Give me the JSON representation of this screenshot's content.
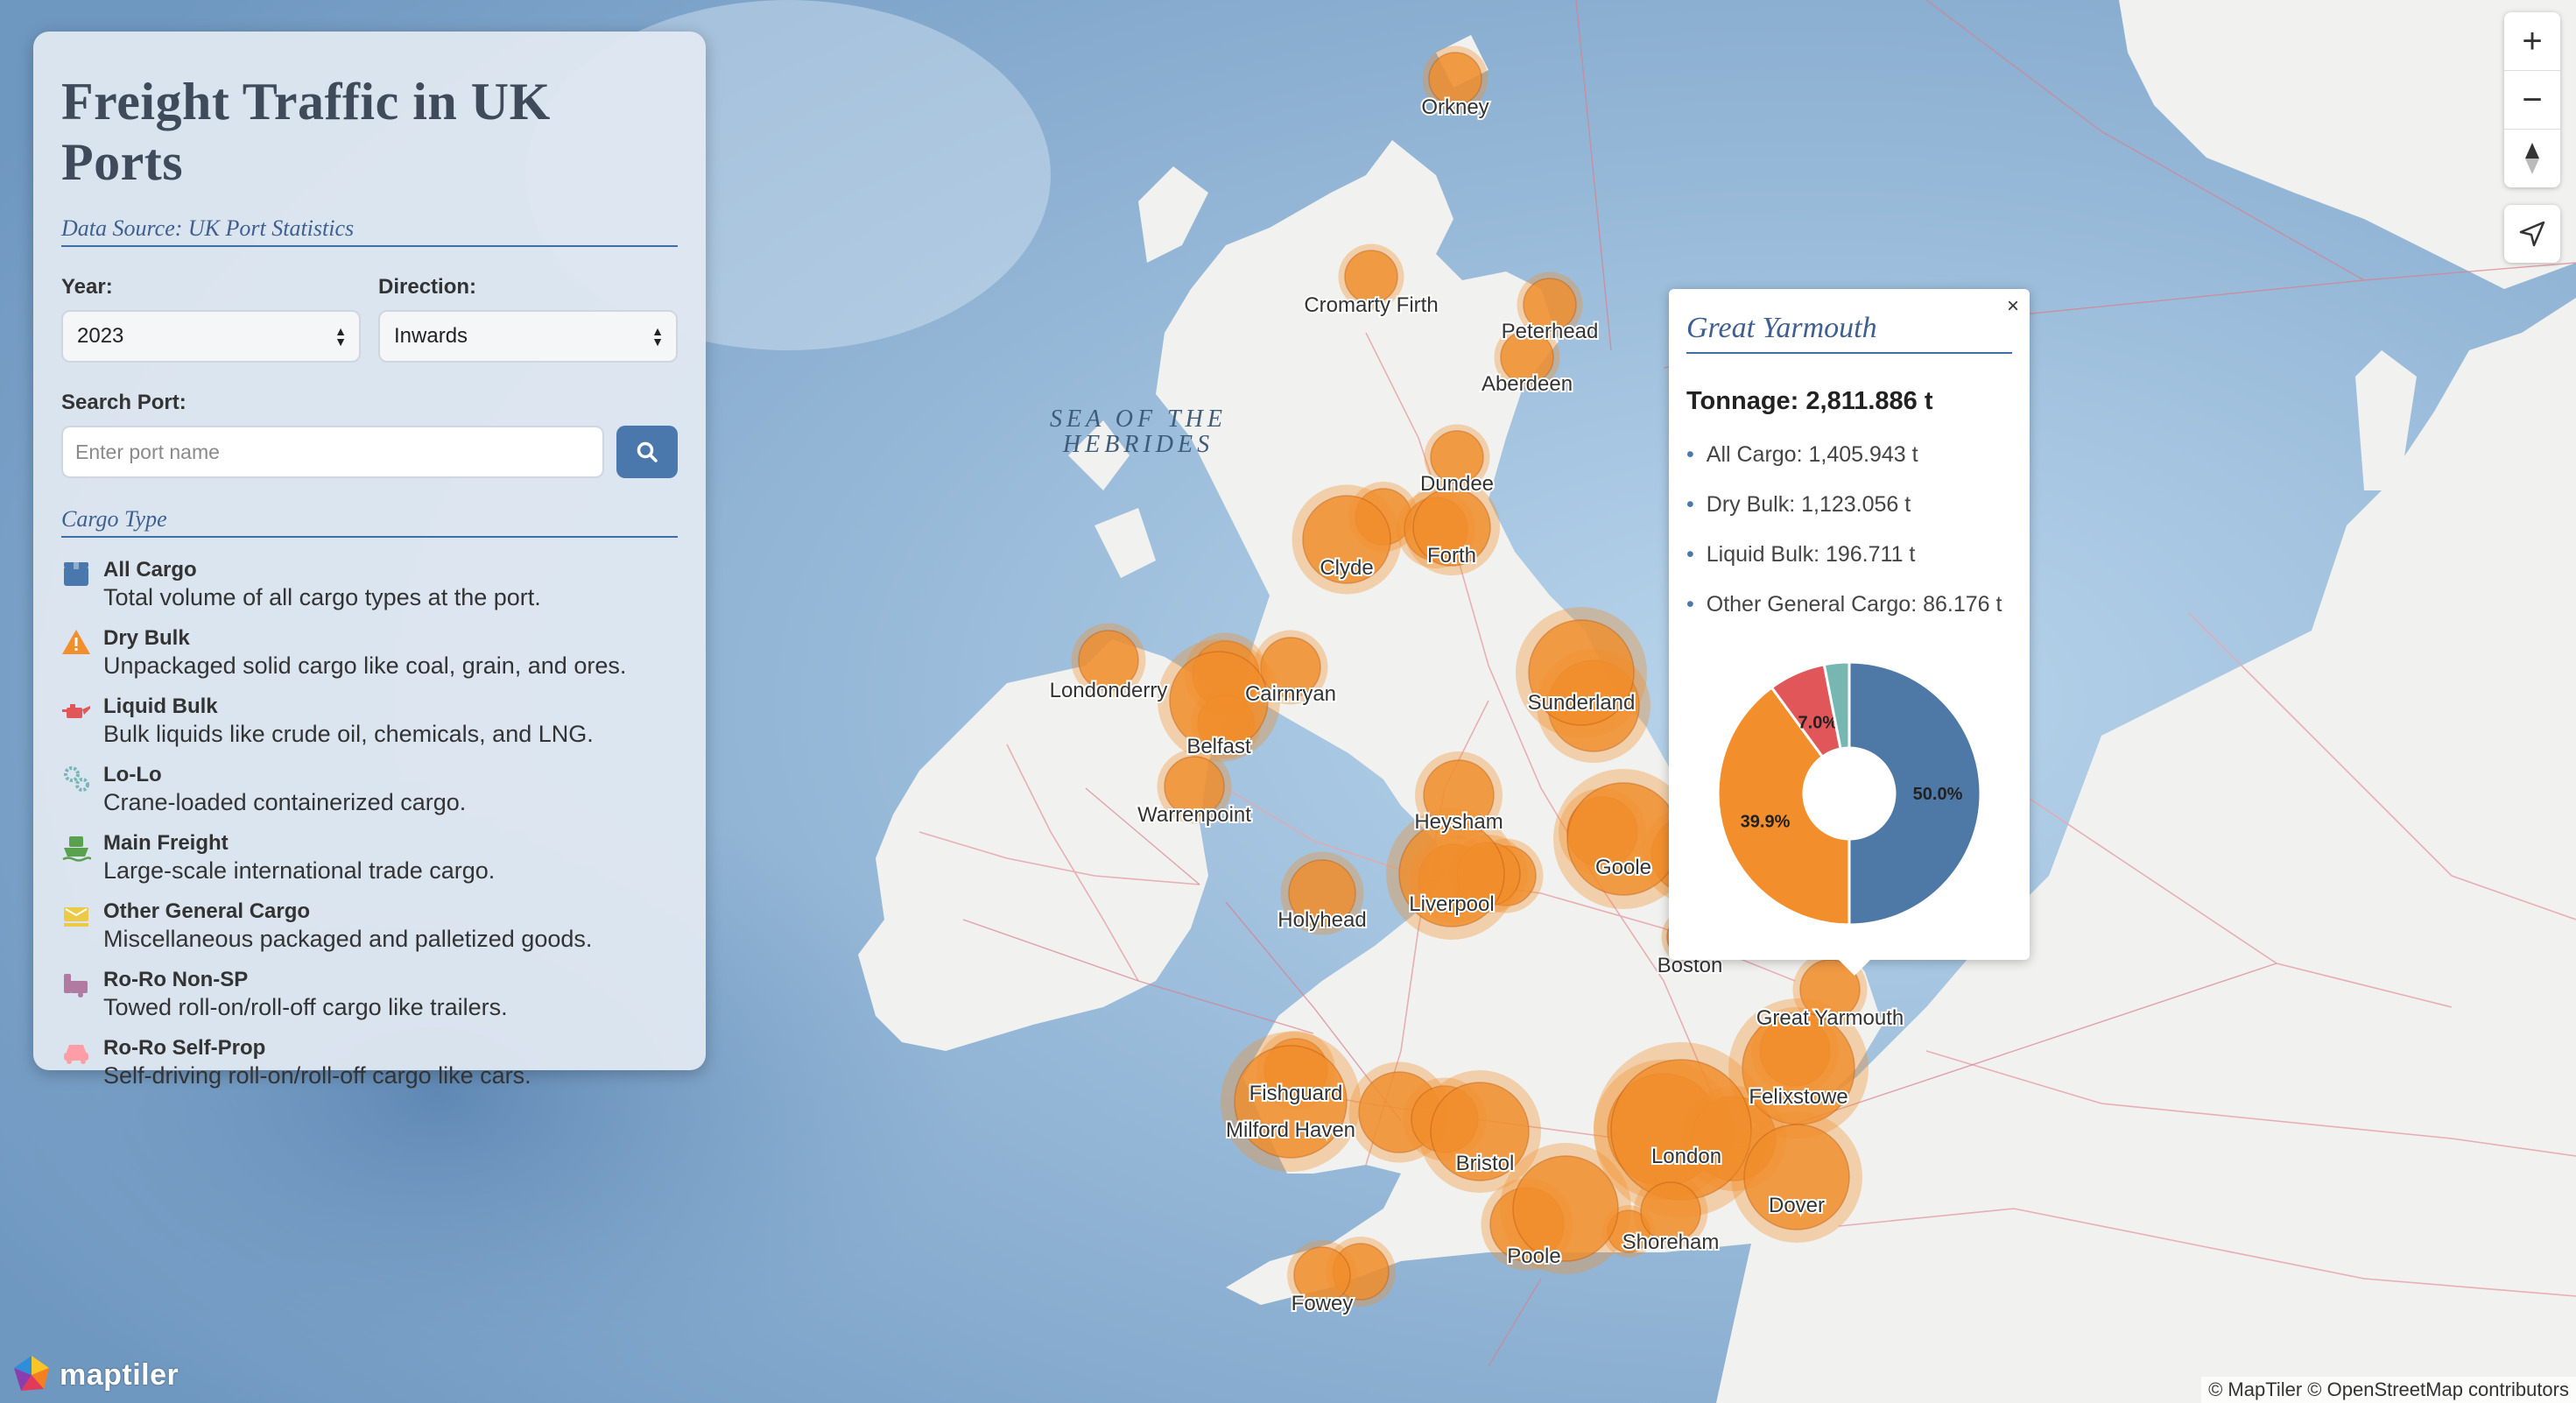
{
  "panel": {
    "title": "Freight Traffic in UK Ports",
    "data_source": "Data Source: UK Port Statistics",
    "year_label": "Year:",
    "year_value": "2023",
    "direction_label": "Direction:",
    "direction_value": "Inwards",
    "search_label": "Search Port:",
    "search_placeholder": "Enter port name",
    "cargo_title": "Cargo Type",
    "cargo_types": [
      {
        "name": "All Cargo",
        "desc": "Total volume of all cargo types at the port.",
        "icon": "box-icon",
        "color": "#4a78ad"
      },
      {
        "name": "Dry Bulk",
        "desc": "Unpackaged solid cargo like coal, grain, and ores.",
        "icon": "warning-triangle-icon",
        "color": "#f28e2b"
      },
      {
        "name": "Liquid Bulk",
        "desc": "Bulk liquids like crude oil, chemicals, and LNG.",
        "icon": "oil-can-icon",
        "color": "#e15759"
      },
      {
        "name": "Lo-Lo",
        "desc": "Crane-loaded containerized cargo.",
        "icon": "gears-icon",
        "color": "#76b7b2"
      },
      {
        "name": "Main Freight",
        "desc": "Large-scale international trade cargo.",
        "icon": "ship-icon",
        "color": "#59a14f"
      },
      {
        "name": "Other General Cargo",
        "desc": "Miscellaneous packaged and palletized goods.",
        "icon": "pallet-icon",
        "color": "#edc948"
      },
      {
        "name": "Ro-Ro Non-SP",
        "desc": "Towed roll-on/roll-off cargo like trailers.",
        "icon": "trailer-icon",
        "color": "#b07aa1"
      },
      {
        "name": "Ro-Ro Self-Prop",
        "desc": "Self-driving roll-on/roll-off cargo like cars.",
        "icon": "car-icon",
        "color": "#ff9da7"
      }
    ]
  },
  "map": {
    "sea_label_1": "SEA OF THE",
    "sea_label_2": "HEBRIDES",
    "ports": [
      "Orkney",
      "Cromarty Firth",
      "Peterhead",
      "Aberdeen",
      "Dundee",
      "Forth",
      "Clyde",
      "Londonderry",
      "Cairnryan",
      "Belfast",
      "Warrenpoint",
      "Sunderland",
      "Heysham",
      "Goole",
      "Liverpool",
      "Holyhead",
      "Boston",
      "Great Yarmouth",
      "Felixstowe",
      "Fishguard",
      "Milford Haven",
      "Bristol",
      "London",
      "Dover",
      "Poole",
      "Shoreham",
      "Fowey"
    ],
    "bubble_color": "#f28e2b"
  },
  "popup": {
    "title": "Great Yarmouth",
    "close": "×",
    "tonnage": "Tonnage: 2,811.886 t",
    "items": [
      "All Cargo: 1,405.943 t",
      "Dry Bulk: 1,123.056 t",
      "Liquid Bulk: 196.711 t",
      "Other General Cargo: 86.176 t"
    ],
    "pie": [
      {
        "name": "All Cargo",
        "value": 1405.943,
        "label": "50.0%",
        "color": "#4e79a7"
      },
      {
        "name": "Dry Bulk",
        "value": 1123.056,
        "label": "39.9%",
        "color": "#f28e2b"
      },
      {
        "name": "Liquid Bulk",
        "value": 196.711,
        "label": "7.0%",
        "color": "#e15759"
      },
      {
        "name": "Other General Cargo",
        "value": 86.176,
        "label": "",
        "color": "#76b7b2"
      }
    ]
  },
  "controls": {
    "zoom_in": "+",
    "zoom_out": "−"
  },
  "footer": {
    "logo": "maptiler",
    "attribution": "© MapTiler © OpenStreetMap contributors"
  }
}
